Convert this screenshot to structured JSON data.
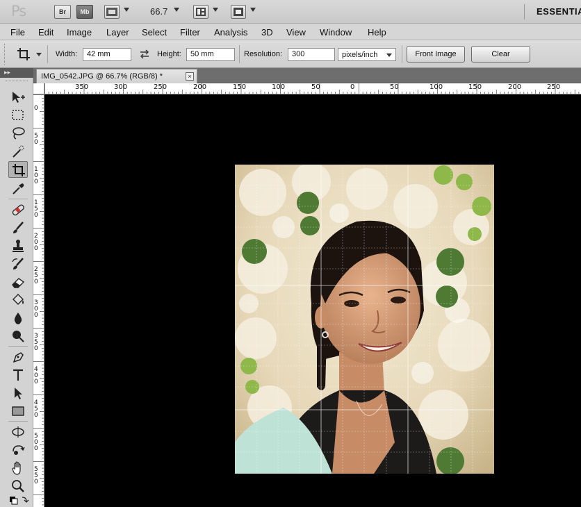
{
  "appbar": {
    "logo": "Ps",
    "bridge_label": "Br",
    "minibridge_label": "Mb",
    "zoom_value": "66.7",
    "workspace_label": "ESSENTIA"
  },
  "menu": {
    "items": [
      "File",
      "Edit",
      "Image",
      "Layer",
      "Select",
      "Filter",
      "Analysis",
      "3D",
      "View",
      "Window",
      "Help"
    ]
  },
  "options": {
    "width_label": "Width:",
    "width_value": "42 mm",
    "height_label": "Height:",
    "height_value": "50 mm",
    "resolution_label": "Resolution:",
    "resolution_value": "300",
    "resolution_unit": "pixels/inch",
    "front_image_label": "Front Image",
    "clear_label": "Clear"
  },
  "document": {
    "tab_title": "IMG_0542.JPG @ 66.7% (RGB/8) *",
    "close_glyph": "×"
  },
  "rulers": {
    "horizontal": [
      "350",
      "300",
      "250",
      "200",
      "150",
      "100",
      "50",
      "0",
      "50",
      "100",
      "150",
      "200",
      "250"
    ],
    "vertical": [
      "0",
      "5 0",
      "1 0 0",
      "1 5 0",
      "2 0 0",
      "2 5 0",
      "3 0 0",
      "3 5 0",
      "4 0 0",
      "4 5 0",
      "5 0 0",
      "5 5 0"
    ]
  },
  "toolbar": {
    "tools": [
      "move-tool",
      "marquee-tool",
      "lasso-tool",
      "quick-selection-tool",
      "crop-tool",
      "eyedropper-tool",
      "healing-brush-tool",
      "brush-tool",
      "clone-stamp-tool",
      "history-brush-tool",
      "eraser-tool",
      "paint-bucket-tool",
      "blur-tool",
      "dodge-tool",
      "pen-tool",
      "type-tool",
      "path-selection-tool",
      "rectangle-tool",
      "3d-rotate-tool",
      "3d-orbit-tool",
      "hand-tool",
      "zoom-tool"
    ],
    "active_tool": "crop-tool"
  },
  "colors": {
    "canvas_bg": "#000000",
    "chrome_bg": "#d6d6d6",
    "tabstrip_bg": "#6e6e6e"
  }
}
